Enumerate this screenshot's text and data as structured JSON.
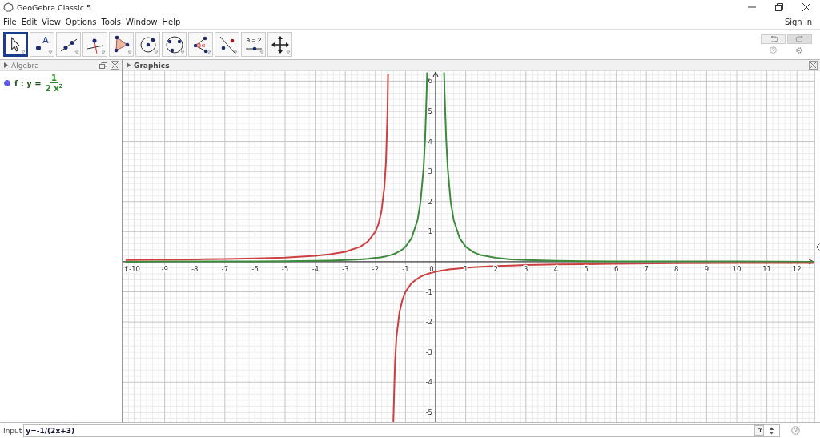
{
  "window": {
    "title": "GeoGebra Classic 5"
  },
  "menu": [
    "File",
    "Edit",
    "View",
    "Options",
    "Tools",
    "Window",
    "Help"
  ],
  "sign_in": "Sign in",
  "tools": [
    {
      "selected": true
    },
    {
      "selected": false,
      "label": "A"
    },
    {
      "selected": false
    },
    {
      "selected": false
    },
    {
      "selected": false
    },
    {
      "selected": false
    },
    {
      "selected": false
    },
    {
      "selected": false,
      "label": "α"
    },
    {
      "selected": false
    },
    {
      "selected": false,
      "label": "a = 2"
    },
    {
      "selected": false
    }
  ],
  "algebra": {
    "title": "Algebra",
    "items": [
      {
        "visible": true,
        "lhs": "f : y =",
        "numerator": "1",
        "denominator": "2 x$^{2}$"
      }
    ]
  },
  "graphics": {
    "title": "Graphics",
    "origin_label": "0",
    "chart_data": {
      "type": "line",
      "xlim": [
        -10.4,
        12.58
      ],
      "ylim": [
        -5.35,
        6.33
      ],
      "xticks": [
        -10,
        -9,
        -8,
        -7,
        -6,
        -5,
        -4,
        -3,
        -2,
        -1,
        1,
        2,
        3,
        4,
        5,
        6,
        7,
        8,
        9,
        10,
        11,
        12
      ],
      "grid": true,
      "yticks": [
        -5,
        -4,
        -3,
        -2,
        -1,
        1,
        2,
        3,
        4,
        5,
        6
      ],
      "x": [
        -10.3,
        -9,
        -8,
        -7,
        -6,
        -5,
        -4,
        -3.5,
        -3,
        -2.5,
        -2.25,
        -2,
        -1.9,
        -1.8,
        -1.7,
        -1.65,
        -1.6,
        -1.58,
        -1.5,
        -1.406,
        -1.35,
        -1.3,
        -1.2,
        -1.1,
        -1,
        -0.8,
        -0.6,
        -0.5,
        -0.4,
        -0.35,
        -0.3,
        -0.282,
        0,
        0.282,
        0.3,
        0.35,
        0.4,
        0.5,
        0.6,
        0.8,
        1,
        1.25,
        1.5,
        2,
        2.5,
        3,
        4,
        5,
        6,
        8,
        10,
        12.55
      ],
      "series": [
        {
          "name": "f",
          "color": "#3c8a3c",
          "values": [
            0,
            0.01,
            0.01,
            0.01,
            0.01,
            0.02,
            0.03,
            0.04,
            0.06,
            0.08,
            0.1,
            0.13,
            0.14,
            0.15,
            0.17,
            0.18,
            0.2,
            0.2,
            0.22,
            0.25,
            0.27,
            0.3,
            0.35,
            0.41,
            0.5,
            0.78,
            1.39,
            2,
            3.13,
            4.08,
            5.56,
            6.29,
            null,
            6.29,
            5.56,
            4.08,
            3.13,
            2,
            1.39,
            0.78,
            0.5,
            0.32,
            0.22,
            0.13,
            0.08,
            0.06,
            0.03,
            0.02,
            0.01,
            0.01,
            0.01,
            0
          ]
        },
        {
          "color": "#cc4040",
          "values": [
            0.06,
            0.07,
            0.08,
            0.09,
            0.11,
            0.14,
            0.2,
            0.25,
            0.33,
            0.5,
            0.67,
            1,
            1.25,
            1.67,
            2.5,
            3.33,
            5,
            6.25,
            null,
            -5.32,
            -3.33,
            -2.5,
            -1.67,
            -1.25,
            -1,
            -0.71,
            -0.56,
            -0.5,
            -0.45,
            -0.43,
            -0.42,
            -0.41,
            -0.33,
            -0.28,
            -0.28,
            -0.27,
            -0.26,
            -0.25,
            -0.24,
            -0.22,
            -0.2,
            -0.18,
            -0.17,
            -0.14,
            -0.13,
            -0.11,
            -0.09,
            -0.08,
            -0.07,
            -0.05,
            -0.04,
            -0.04
          ]
        }
      ]
    }
  },
  "input": {
    "label": "Input",
    "value": "y=-1/(2x+3)",
    "alpha": "α"
  }
}
